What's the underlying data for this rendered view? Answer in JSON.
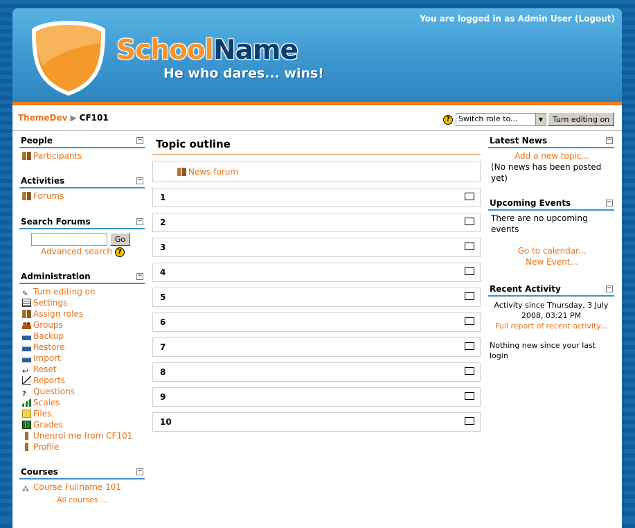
{
  "header": {
    "site_title_part1": "School",
    "site_title_part2": "Name",
    "tagline": "He who dares... wins!",
    "login_prefix": "You are logged in as",
    "login_user": "Admin User",
    "logout_label": "(Logout)"
  },
  "navbar": {
    "breadcrumb_root": "ThemeDev",
    "breadcrumb_separator": "▶",
    "breadcrumb_current": "CF101",
    "help_symbol": "?",
    "role_select_value": "Switch role to...",
    "edit_button": "Turn editing on"
  },
  "left": {
    "people": {
      "title": "People",
      "items": [
        {
          "label": "Participants",
          "icon": "people-icon"
        }
      ]
    },
    "activities": {
      "title": "Activities",
      "items": [
        {
          "label": "Forums",
          "icon": "forum-icon"
        }
      ]
    },
    "search": {
      "title": "Search Forums",
      "input_value": "",
      "go_button": "Go",
      "advanced_link": "Advanced search",
      "help_symbol": "?"
    },
    "admin": {
      "title": "Administration",
      "items": [
        {
          "label": "Turn editing on",
          "icon": "edit-icon"
        },
        {
          "label": "Settings",
          "icon": "settings-icon"
        },
        {
          "label": "Assign roles",
          "icon": "roles-icon"
        },
        {
          "label": "Groups",
          "icon": "groups-icon"
        },
        {
          "label": "Backup",
          "icon": "backup-icon"
        },
        {
          "label": "Restore",
          "icon": "restore-icon"
        },
        {
          "label": "Import",
          "icon": "import-icon"
        },
        {
          "label": "Reset",
          "icon": "reset-icon"
        },
        {
          "label": "Reports",
          "icon": "reports-icon"
        },
        {
          "label": "Questions",
          "icon": "questions-icon"
        },
        {
          "label": "Scales",
          "icon": "scales-icon"
        },
        {
          "label": "Files",
          "icon": "folder-icon"
        },
        {
          "label": "Grades",
          "icon": "grades-icon"
        },
        {
          "label": "Unenrol me from CF101",
          "icon": "unenrol-icon"
        },
        {
          "label": "Profile",
          "icon": "profile-icon"
        }
      ]
    },
    "courses": {
      "title": "Courses",
      "items": [
        {
          "label": "Course Fullname 101",
          "icon": "course-icon"
        }
      ],
      "all_link": "All courses ..."
    }
  },
  "main": {
    "title": "Topic outline",
    "news_forum": "News forum",
    "sections": [
      "1",
      "2",
      "3",
      "4",
      "5",
      "6",
      "7",
      "8",
      "9",
      "10"
    ]
  },
  "right": {
    "news": {
      "title": "Latest News",
      "add_link": "Add a new topic...",
      "empty_text": "(No news has been posted yet)"
    },
    "events": {
      "title": "Upcoming Events",
      "empty_text": "There are no upcoming events",
      "calendar_link": "Go to calendar...",
      "new_event_link": "New Event..."
    },
    "activity": {
      "title": "Recent Activity",
      "since_text": "Activity since Thursday, 3 July 2008, 03:21 PM",
      "full_report_link": "Full report of recent activity...",
      "nothing_text": "Nothing new since your last login"
    }
  },
  "colors": {
    "link": "#e8731a",
    "accent_blue": "#3a93cf",
    "header_bottom": "#f07d1e"
  }
}
